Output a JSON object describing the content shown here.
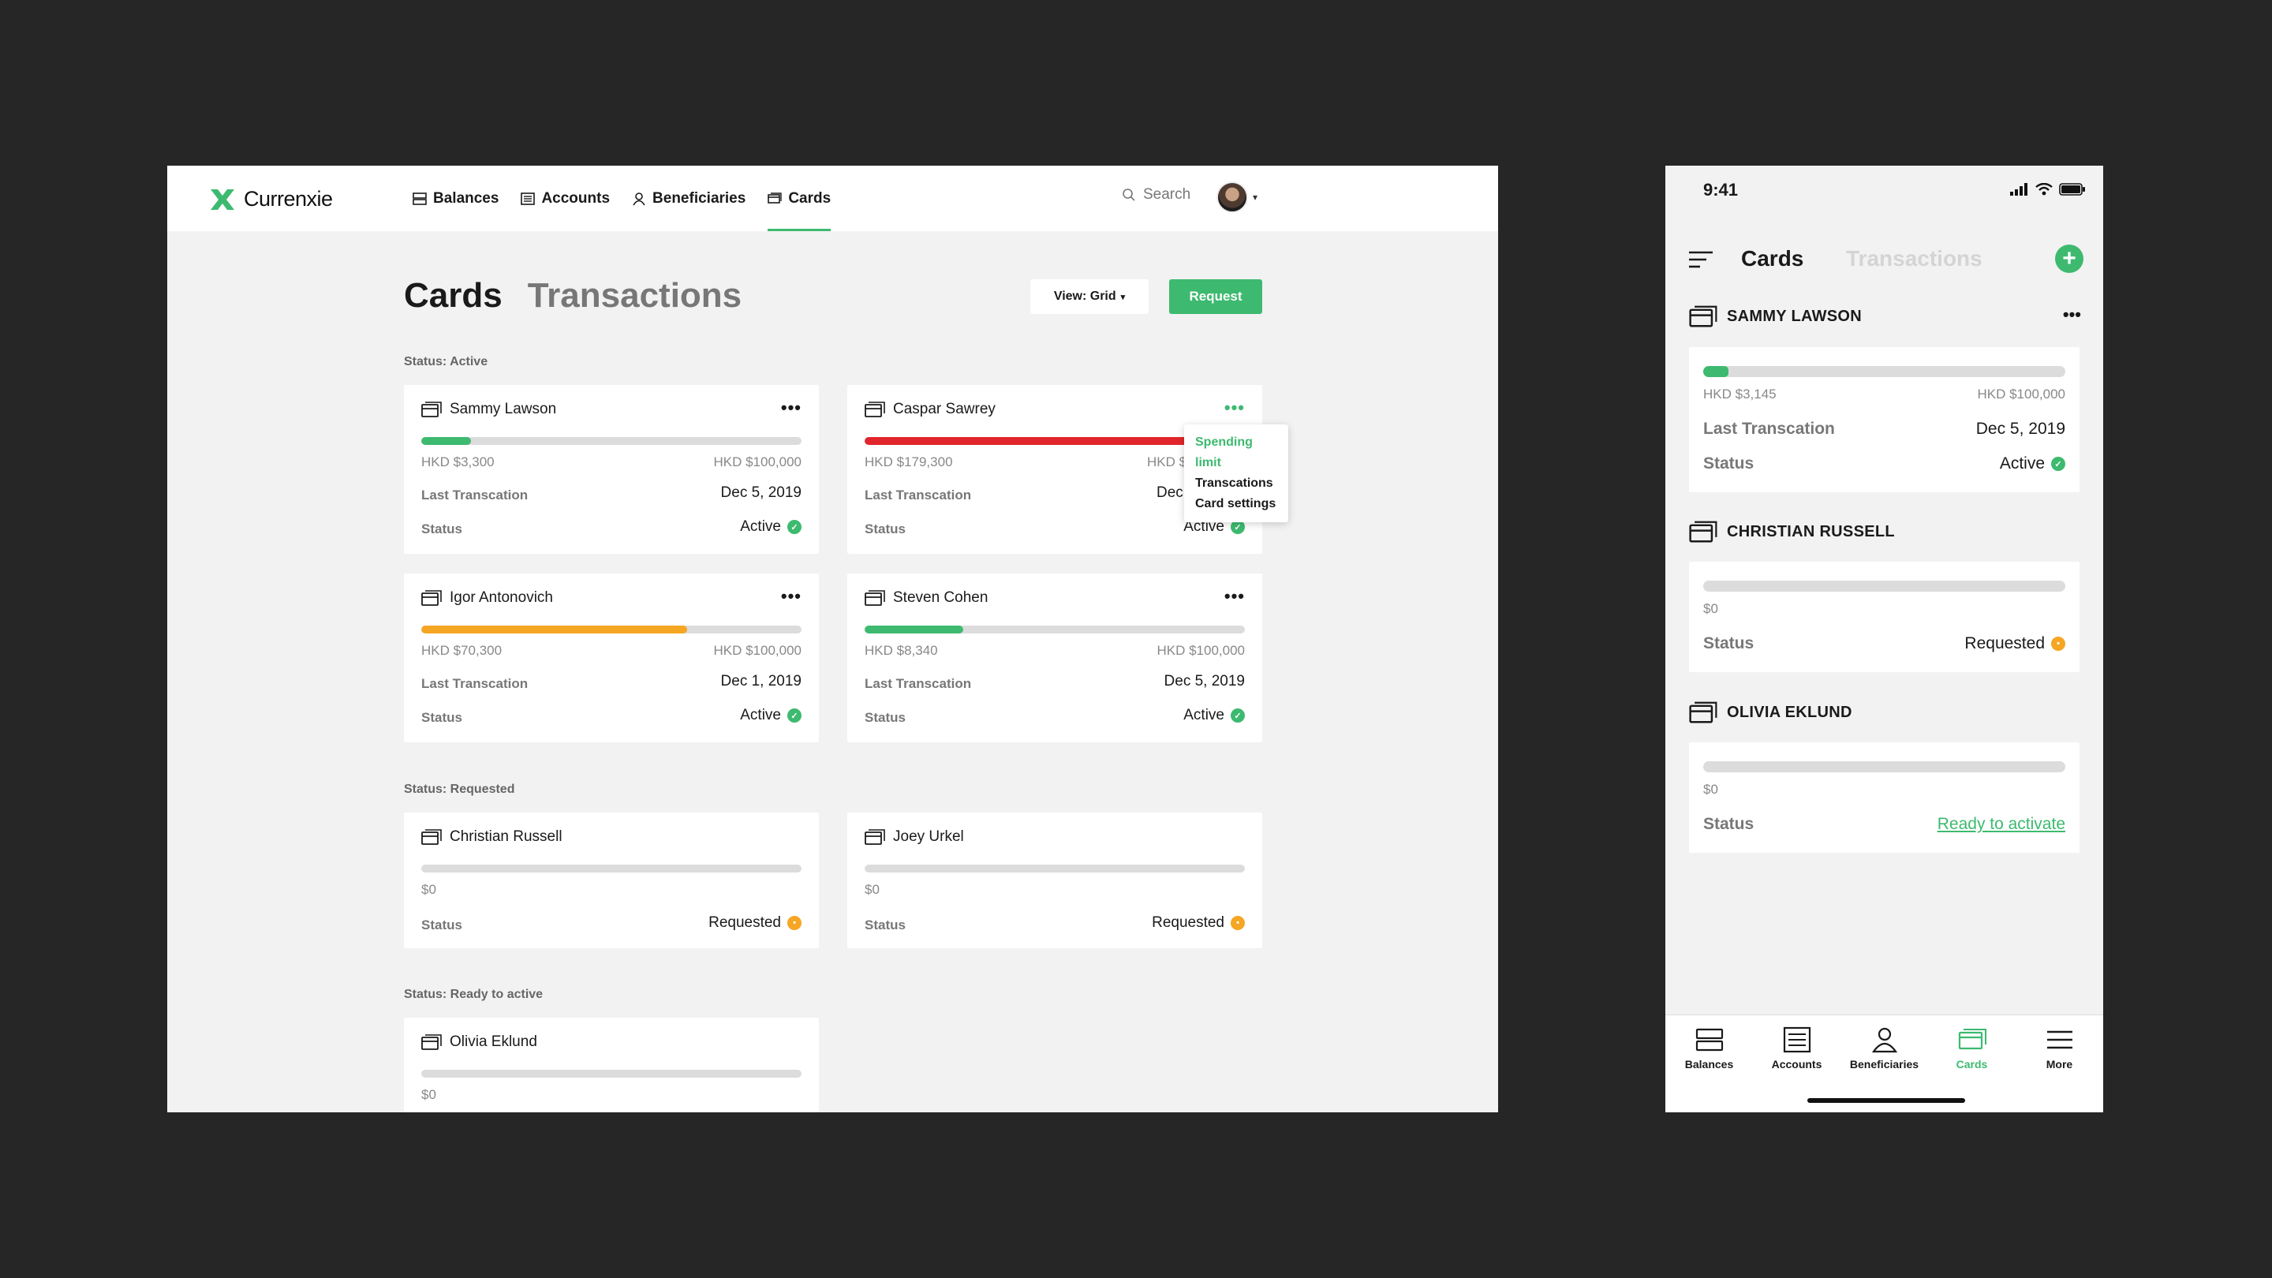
{
  "brand": {
    "name": "Currenxie",
    "accent": "#3dba6f"
  },
  "nav": {
    "items": [
      {
        "label": "Balances",
        "icon": "balances-icon"
      },
      {
        "label": "Accounts",
        "icon": "accounts-icon"
      },
      {
        "label": "Beneficiaries",
        "icon": "beneficiaries-icon"
      },
      {
        "label": "Cards",
        "icon": "cards-icon",
        "active": true
      }
    ],
    "search_label": "Search"
  },
  "page": {
    "tab_active": "Cards",
    "tab_inactive": "Transactions",
    "view_label": "View: Grid",
    "request_label": "Request"
  },
  "sections": {
    "active": "Status: Active",
    "requested": "Status: Requested",
    "ready": "Status: Ready to active"
  },
  "labels": {
    "last_txn": "Last Transcation",
    "status": "Status"
  },
  "cards": {
    "sammy": {
      "name": "Sammy Lawson",
      "spent": "HKD $3,300",
      "limit": "HKD $100,000",
      "fill": 0.13,
      "color": "#3dba6f",
      "last": "Dec  5, 2019",
      "status": "Active"
    },
    "caspar": {
      "name": "Caspar Sawrey",
      "spent": "HKD $179,300",
      "limit": "HKD $",
      "fill": 1.0,
      "color": "#e0262c",
      "last": "Dec",
      "status": "Active"
    },
    "igor": {
      "name": "Igor Antonovich",
      "spent": "HKD $70,300",
      "limit": "HKD $100,000",
      "fill": 0.7,
      "color": "#f5a623",
      "last": "Dec  1, 2019",
      "status": "Active"
    },
    "steven": {
      "name": "Steven Cohen",
      "spent": "HKD $8,340",
      "limit": "HKD $100,000",
      "fill": 0.26,
      "color": "#3dba6f",
      "last": "Dec  5, 2019",
      "status": "Active"
    },
    "christian": {
      "name": "Christian Russell",
      "spent": "$0",
      "status": "Requested"
    },
    "joey": {
      "name": "Joey Urkel",
      "spent": "$0",
      "status": "Requested"
    },
    "olivia": {
      "name": "Olivia Eklund",
      "spent": "$0"
    }
  },
  "popover": {
    "items": [
      "Spending limit",
      "Transcations",
      "Card settings"
    ]
  },
  "mobile": {
    "time": "9:41",
    "tab_active": "Cards",
    "tab_inactive": "Transactions",
    "cards": {
      "sammy": {
        "name": "SAMMY LAWSON",
        "spent": "HKD $3,145",
        "limit": "HKD $100,000",
        "fill": 0.07,
        "last_label": "Last Transcation",
        "last": "Dec  5, 2019",
        "status_label": "Status",
        "status": "Active"
      },
      "christian": {
        "name": "CHRISTIAN RUSSELL",
        "spent": "$0",
        "status_label": "Status",
        "status": "Requested"
      },
      "olivia": {
        "name": "OLIVIA EKLUND",
        "spent": "$0",
        "status_label": "Status",
        "status": "Ready to activate"
      }
    },
    "tabs": [
      "Balances",
      "Accounts",
      "Beneficiaries",
      "Cards",
      "More"
    ]
  }
}
